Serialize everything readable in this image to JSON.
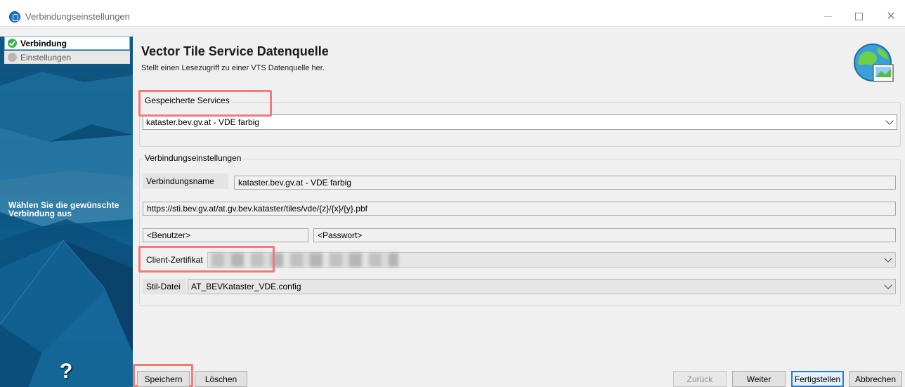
{
  "window": {
    "title": "Verbindungseinstellungen"
  },
  "sidebar": {
    "items": [
      {
        "label": "Verbindung",
        "state": "done"
      },
      {
        "label": "Einstellungen",
        "state": "pending"
      }
    ],
    "instruction": "Wählen Sie die gewünschte Verbindung aus",
    "help_glyph": "?"
  },
  "header": {
    "title": "Vector Tile Service Datenquelle",
    "subtitle": "Stellt einen Lesezugriff zu einer VTS Datenquelle her."
  },
  "saved_services": {
    "group_label": "Gespeicherte Services",
    "selected": "kataster.bev.gv.at - VDE farbig"
  },
  "connection": {
    "group_label": "Verbindungseinstellungen",
    "name_label": "Verbindungsname",
    "name_value": "kataster.bev.gv.at - VDE farbig",
    "url_value": "https://sti.bev.gv.at/at.gv.bev.kataster/tiles/vde/{z}/{x}/{y}.pbf",
    "user_placeholder": "<Benutzer>",
    "password_placeholder": "<Passwort>",
    "certificate_label": "Client-Zertifikat",
    "style_label": "Stil-Datei",
    "style_value": "AT_BEVKataster_VDE.config"
  },
  "buttons": {
    "save": "Speichern",
    "delete": "Löschen",
    "back": "Zurück",
    "next": "Weiter",
    "finish": "Fertigstellen",
    "cancel": "Abbrechen"
  },
  "colors": {
    "highlight": "#ef7b7b",
    "accent": "#2a79d0",
    "sidebar": "#0a4a72"
  }
}
